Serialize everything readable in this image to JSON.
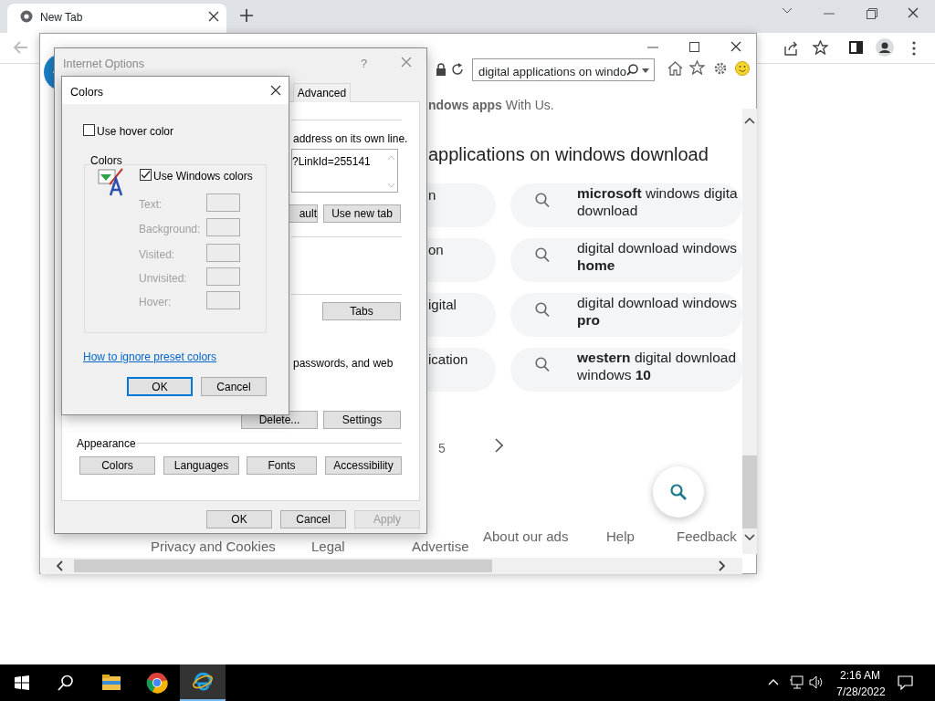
{
  "browser": {
    "tab_title": "New Tab"
  },
  "ie_window": {
    "address_search": "digital applications on windo",
    "page": {
      "intro": "**ndows apps** With Us.",
      "heading": "applications on windows download",
      "left_fragments": [
        "n",
        "on",
        "igital",
        "ication"
      ],
      "suggestions": [
        {
          "lines": [
            "**microsoft** windows digita",
            "download"
          ]
        },
        {
          "lines": [
            "digital download windows",
            "**home**"
          ]
        },
        {
          "lines": [
            "digital download windows",
            "**pro**"
          ]
        },
        {
          "lines": [
            "**western** digital download",
            "windows **10**"
          ]
        }
      ],
      "page_number": "5",
      "footer_links": [
        "Privacy and Cookies",
        "Legal",
        "Advertise",
        "About our ads",
        "Help",
        "Feedback"
      ]
    }
  },
  "internet_options": {
    "title": "Internet Options",
    "help": "?",
    "tab": "Advanced",
    "home_text": "address on its own line.",
    "url_text": "?LinkId=255141",
    "home_buttons": [
      "ault",
      "Use new tab"
    ],
    "tabs_button": "Tabs",
    "history_text": "passwords, and web",
    "history_buttons": [
      "Delete...",
      "Settings"
    ],
    "appearance_label": "Appearance",
    "appearance_buttons": [
      "Colors",
      "Languages",
      "Fonts",
      "Accessibility"
    ],
    "footer_buttons": [
      {
        "label": "OK",
        "disabled": false
      },
      {
        "label": "Cancel",
        "disabled": false
      },
      {
        "label": "Apply",
        "disabled": true
      }
    ]
  },
  "colors_dialog": {
    "title": "Colors",
    "use_hover": {
      "label": "Use hover color",
      "checked": false
    },
    "group_label": "Colors",
    "use_windows": {
      "label": "Use Windows colors",
      "checked": true
    },
    "color_rows": [
      {
        "label": "Text:",
        "disabled": true
      },
      {
        "label": "Background:",
        "disabled": true
      },
      {
        "label": "Visited:",
        "disabled": true
      },
      {
        "label": "Unvisited:",
        "disabled": true
      },
      {
        "label": "Hover:",
        "disabled": true
      }
    ],
    "help_link": "How to ignore preset colors",
    "buttons": [
      {
        "label": "OK",
        "focused": true
      },
      {
        "label": "Cancel",
        "focused": false
      }
    ]
  },
  "taskbar": {
    "apps": [
      {
        "kind": "explorer",
        "active": false
      },
      {
        "kind": "chrome",
        "active": false
      },
      {
        "kind": "ie",
        "active": true
      }
    ],
    "time": "2:16 AM",
    "date": "7/28/2022"
  }
}
